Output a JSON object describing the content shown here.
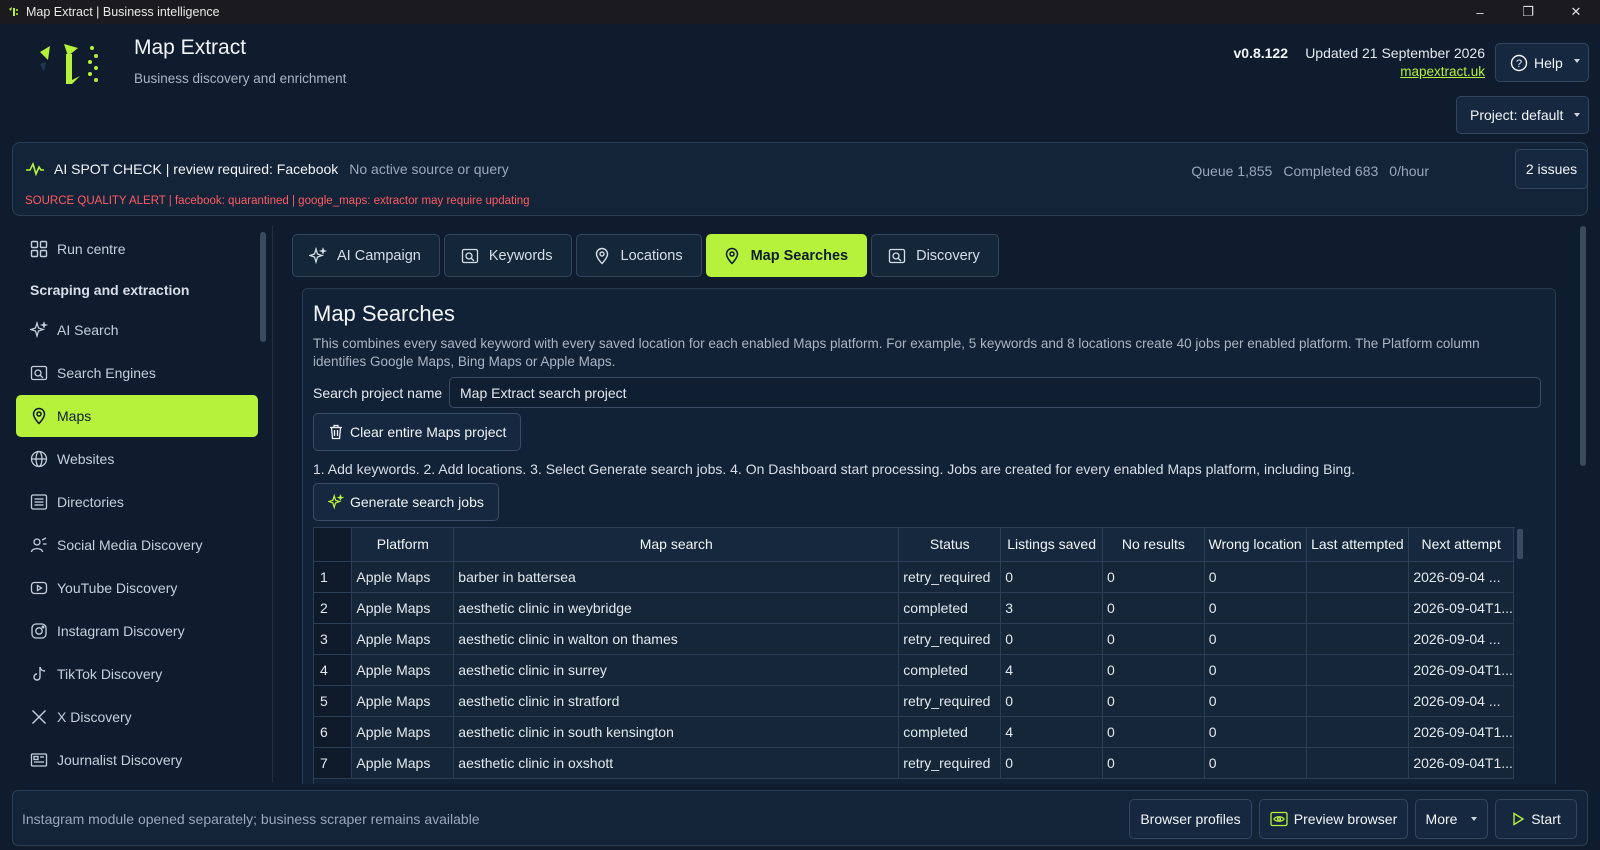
{
  "window": {
    "title": "Map Extract | Business intelligence"
  },
  "header": {
    "app_name": "Map Extract",
    "tagline": "Business discovery and enrichment",
    "version": "v0.8.122",
    "updated": "Updated 21 September 2026",
    "site": "mapextract.uk",
    "help_label": "Help",
    "project_label": "Project: default"
  },
  "status": {
    "title": "AI SPOT CHECK | review required: Facebook",
    "subtitle": "No active source or query",
    "alert": "SOURCE QUALITY ALERT | facebook: quarantined | google_maps: extractor may require updating",
    "queue": "Queue 1,855",
    "completed": "Completed 683",
    "rate": "0/hour",
    "issues_label": "2 issues"
  },
  "sidebar": {
    "run_centre": "Run centre",
    "heading": "Scraping and extraction",
    "items": [
      {
        "label": "AI Search",
        "icon": "sparkle-icon"
      },
      {
        "label": "Search Engines",
        "icon": "search-engine-icon"
      },
      {
        "label": "Maps",
        "icon": "map-pin-icon"
      },
      {
        "label": "Websites",
        "icon": "globe-icon"
      },
      {
        "label": "Directories",
        "icon": "list-icon"
      },
      {
        "label": "Social Media Discovery",
        "icon": "user-network-icon"
      },
      {
        "label": "YouTube Discovery",
        "icon": "youtube-icon"
      },
      {
        "label": "Instagram Discovery",
        "icon": "instagram-icon"
      },
      {
        "label": "TikTok Discovery",
        "icon": "tiktok-icon"
      },
      {
        "label": "X Discovery",
        "icon": "x-icon"
      },
      {
        "label": "Journalist Discovery",
        "icon": "newspaper-icon"
      }
    ],
    "active": "Maps"
  },
  "tabs": [
    {
      "label": "AI Campaign",
      "icon": "sparkle-icon"
    },
    {
      "label": "Keywords",
      "icon": "keyword-search-icon"
    },
    {
      "label": "Locations",
      "icon": "map-pin-icon"
    },
    {
      "label": "Map Searches",
      "icon": "map-pin-icon"
    },
    {
      "label": "Discovery",
      "icon": "discovery-icon"
    }
  ],
  "active_tab": "Map Searches",
  "map_searches": {
    "title": "Map Searches",
    "description": "This combines every saved keyword with every saved location for each enabled Maps platform. For example, 5 keywords and 8 locations create 40 jobs per enabled platform. The Platform column identifies Google Maps, Bing Maps or Apple Maps.",
    "project_name_label": "Search project name",
    "project_name_value": "Map Extract search project",
    "clear_label": "Clear entire Maps project",
    "steps": "1. Add keywords.  2. Add locations.  3. Select Generate search jobs.  4. On Dashboard start processing. Jobs are created for every enabled Maps platform, including Bing.",
    "generate_label": "Generate search jobs"
  },
  "table": {
    "columns": [
      "Platform",
      "Map search",
      "Status",
      "Listings saved",
      "No results",
      "Wrong location",
      "Last attempted",
      "Next attempt"
    ],
    "rows": [
      [
        "1",
        "Apple Maps",
        "barber in battersea",
        "retry_required",
        "0",
        "0",
        "0",
        "",
        "2026-09-04 ..."
      ],
      [
        "2",
        "Apple Maps",
        "aesthetic clinic in weybridge",
        "completed",
        "3",
        "0",
        "0",
        "",
        "2026-09-04T1..."
      ],
      [
        "3",
        "Apple Maps",
        "aesthetic clinic in walton on thames",
        "retry_required",
        "0",
        "0",
        "0",
        "",
        "2026-09-04 ..."
      ],
      [
        "4",
        "Apple Maps",
        "aesthetic clinic in surrey",
        "completed",
        "4",
        "0",
        "0",
        "",
        "2026-09-04T1..."
      ],
      [
        "5",
        "Apple Maps",
        "aesthetic clinic in stratford",
        "retry_required",
        "0",
        "0",
        "0",
        "",
        "2026-09-04 ..."
      ],
      [
        "6",
        "Apple Maps",
        "aesthetic clinic in south kensington",
        "completed",
        "4",
        "0",
        "0",
        "",
        "2026-09-04T1..."
      ],
      [
        "7",
        "Apple Maps",
        "aesthetic clinic in oxshott",
        "retry_required",
        "0",
        "0",
        "0",
        "",
        "2026-09-04T1..."
      ]
    ]
  },
  "footer": {
    "message": "Instagram module opened separately; business scraper remains available",
    "browser_profiles": "Browser profiles",
    "preview_browser": "Preview browser",
    "more": "More",
    "start": "Start"
  },
  "colors": {
    "accent": "#b6f13b",
    "background": "#0f1c2e",
    "alert": "#ff5a63"
  }
}
